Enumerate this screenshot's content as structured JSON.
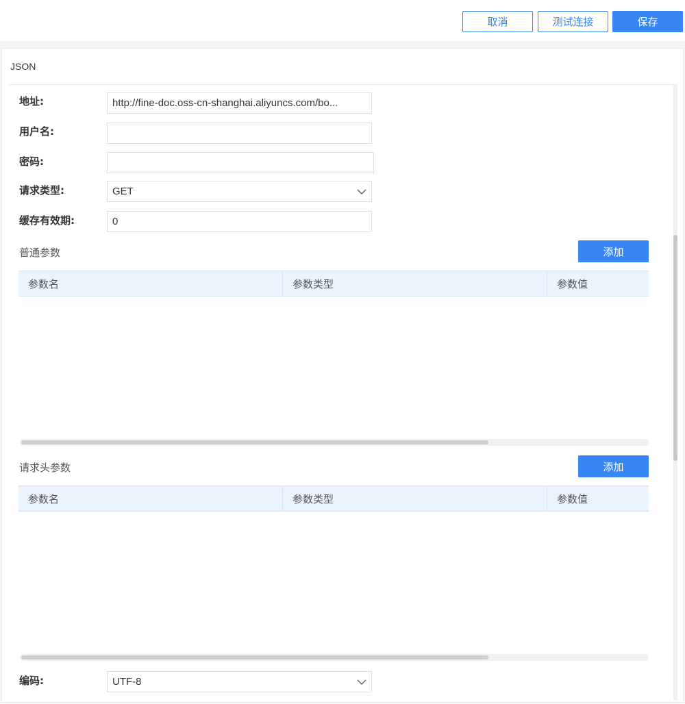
{
  "toolbar": {
    "cancel_label": "取消",
    "test_label": "测试连接",
    "save_label": "保存"
  },
  "panel": {
    "title": "JSON"
  },
  "form": {
    "address": {
      "label": "地址:",
      "value": "http://fine-doc.oss-cn-shanghai.aliyuncs.com/bo..."
    },
    "username": {
      "label": "用户名:",
      "value": ""
    },
    "password": {
      "label": "密码:",
      "value": ""
    },
    "request_type": {
      "label": "请求类型:",
      "value": "GET"
    },
    "cache_period": {
      "label": "缓存有效期:",
      "value": "0"
    },
    "encoding": {
      "label": "编码:",
      "value": "UTF-8"
    }
  },
  "params": {
    "title": "普通参数",
    "add_label": "添加",
    "columns": [
      "参数名",
      "参数类型",
      "参数值"
    ]
  },
  "headers": {
    "title": "请求头参数",
    "add_label": "添加",
    "columns": [
      "参数名",
      "参数类型",
      "参数值"
    ]
  },
  "colors": {
    "primary": "#3685f2",
    "table_header_bg": "#ebf3fd"
  }
}
